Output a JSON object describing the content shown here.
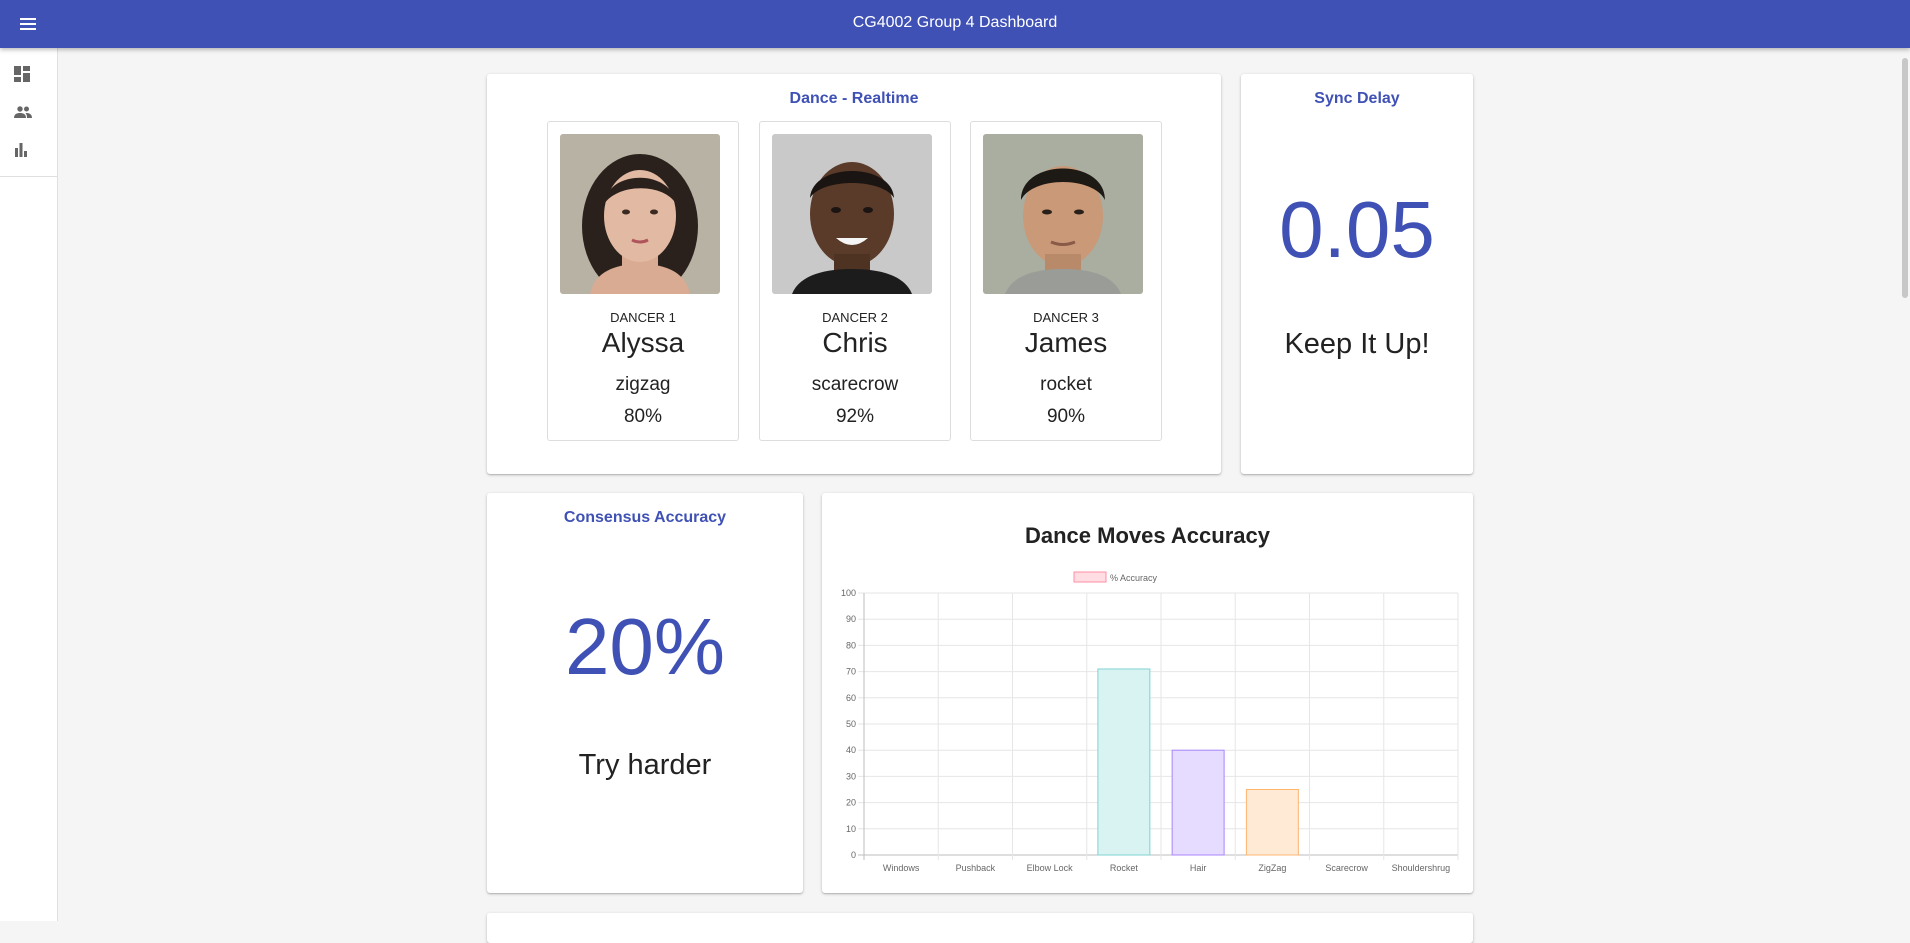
{
  "app": {
    "title": "CG4002 Group 4 Dashboard",
    "primary_color": "#3f51b5"
  },
  "appbar": {
    "menu_icon": "hamburger-menu-icon"
  },
  "sidebar": {
    "items": [
      {
        "icon": "dashboard-icon"
      },
      {
        "icon": "people-icon"
      },
      {
        "icon": "bar-chart-icon"
      }
    ]
  },
  "realtime": {
    "title": "Dance - Realtime",
    "dancers": [
      {
        "role": "DANCER 1",
        "name": "Alyssa",
        "move": "zigzag",
        "accuracy": "80%"
      },
      {
        "role": "DANCER 2",
        "name": "Chris",
        "move": "scarecrow",
        "accuracy": "92%"
      },
      {
        "role": "DANCER 3",
        "name": "James",
        "move": "rocket",
        "accuracy": "90%"
      }
    ]
  },
  "sync": {
    "title": "Sync Delay",
    "value": "0.05",
    "message": "Keep It Up!"
  },
  "consensus": {
    "title": "Consensus Accuracy",
    "value": "20%",
    "message": "Try harder"
  },
  "chart_data": {
    "type": "bar",
    "title": "Dance Moves Accuracy",
    "legend": "% Accuracy",
    "legend_position": "top",
    "categories": [
      "Windows",
      "Pushback",
      "Elbow Lock",
      "Rocket",
      "Hair",
      "ZigZag",
      "Scarecrow",
      "Shouldershrug"
    ],
    "values": [
      0,
      0,
      0,
      71,
      40,
      25,
      0,
      0
    ],
    "colors": [
      {
        "fill": "#ffdde2",
        "stroke": "#ff8fa3"
      },
      {
        "fill": "#d6ecfb",
        "stroke": "#5aaee8"
      },
      {
        "fill": "#fff1d6",
        "stroke": "#ffcb6b"
      },
      {
        "fill": "#d9f3f3",
        "stroke": "#7fd3d3"
      },
      {
        "fill": "#e6dcff",
        "stroke": "#a985ff"
      },
      {
        "fill": "#ffead6",
        "stroke": "#ffb570"
      },
      {
        "fill": "#eeeeee",
        "stroke": "#bbbbbb"
      },
      {
        "fill": "#ffdde2",
        "stroke": "#ff8fa3"
      }
    ],
    "ylim": [
      0,
      100
    ],
    "yticks": [
      0,
      10,
      20,
      30,
      40,
      50,
      60,
      70,
      80,
      90,
      100
    ],
    "grid": true
  }
}
